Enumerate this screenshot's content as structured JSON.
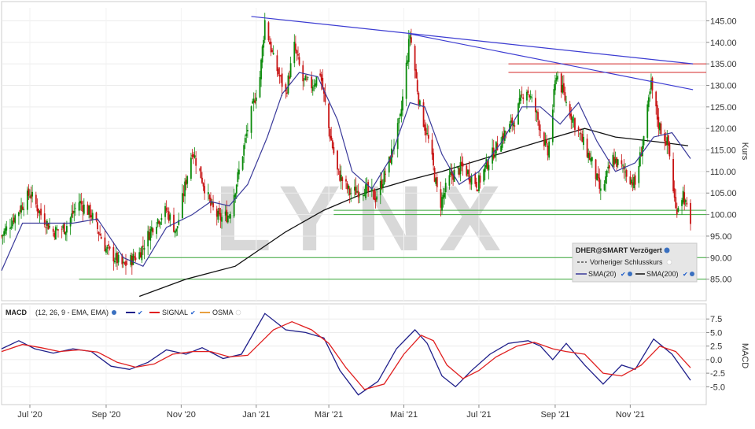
{
  "watermark": "LYNX",
  "chart_data": [
    {
      "type": "candlestick",
      "ylabel": "Kurs",
      "ylim": [
        80,
        148
      ],
      "y_ticks": [
        "85.00",
        "90.00",
        "95.00",
        "100.00",
        "105.00",
        "110.00",
        "115.00",
        "120.00",
        "125.00",
        "130.00",
        "135.00",
        "140.00",
        "145.00"
      ],
      "x_ticks": [
        "Jul '20",
        "Sep '20",
        "Nov '20",
        "Jan '21",
        "Mär '21",
        "Mai '21",
        "Jul '21",
        "Sep '21",
        "Nov '21"
      ],
      "x_range": [
        "2020-06-08",
        "2021-12-20"
      ],
      "legend": {
        "title": "DHER@SMART Verzögert",
        "items": [
          "Vorheriger Schlusskurs",
          "SMA(20)",
          "SMA(200)"
        ]
      },
      "colors": {
        "up": "#0a8a0a",
        "down": "#c81414",
        "sma20": "#3a3a9a",
        "sma200": "#111111",
        "trendline": "#3c3cd2",
        "resistance": "#d42a2a",
        "support": "#3aa83a"
      },
      "price_keypoints": [
        [
          "2020-06-08",
          95
        ],
        [
          "2020-06-22",
          101
        ],
        [
          "2020-07-01",
          105
        ],
        [
          "2020-07-10",
          100
        ],
        [
          "2020-07-20",
          96
        ],
        [
          "2020-07-30",
          97
        ],
        [
          "2020-08-10",
          103
        ],
        [
          "2020-08-20",
          100
        ],
        [
          "2020-09-01",
          92
        ],
        [
          "2020-09-15",
          88
        ],
        [
          "2020-09-28",
          91
        ],
        [
          "2020-10-10",
          98
        ],
        [
          "2020-10-20",
          101
        ],
        [
          "2020-10-28",
          96
        ],
        [
          "2020-11-05",
          108
        ],
        [
          "2020-11-10",
          115
        ],
        [
          "2020-11-16",
          110
        ],
        [
          "2020-11-25",
          102
        ],
        [
          "2020-12-02",
          99
        ],
        [
          "2020-12-10",
          100
        ],
        [
          "2020-12-18",
          110
        ],
        [
          "2020-12-25",
          120
        ],
        [
          "2021-01-04",
          132
        ],
        [
          "2021-01-08",
          145
        ],
        [
          "2021-01-15",
          136
        ],
        [
          "2021-01-25",
          128
        ],
        [
          "2021-02-01",
          139
        ],
        [
          "2021-02-08",
          131
        ],
        [
          "2021-02-15",
          130
        ],
        [
          "2021-02-22",
          133
        ],
        [
          "2021-03-01",
          120
        ],
        [
          "2021-03-08",
          110
        ],
        [
          "2021-03-18",
          105
        ],
        [
          "2021-03-30",
          106
        ],
        [
          "2021-04-08",
          104
        ],
        [
          "2021-04-18",
          111
        ],
        [
          "2021-04-28",
          122
        ],
        [
          "2021-05-06",
          142
        ],
        [
          "2021-05-14",
          125
        ],
        [
          "2021-05-22",
          116
        ],
        [
          "2021-05-30",
          102
        ],
        [
          "2021-06-08",
          109
        ],
        [
          "2021-06-18",
          111
        ],
        [
          "2021-06-30",
          107
        ],
        [
          "2021-07-08",
          112
        ],
        [
          "2021-07-20",
          118
        ],
        [
          "2021-07-30",
          122
        ],
        [
          "2021-08-08",
          130
        ],
        [
          "2021-08-16",
          124
        ],
        [
          "2021-08-26",
          114
        ],
        [
          "2021-09-02",
          133
        ],
        [
          "2021-09-10",
          126
        ],
        [
          "2021-09-20",
          119
        ],
        [
          "2021-10-01",
          112
        ],
        [
          "2021-10-08",
          105
        ],
        [
          "2021-10-18",
          113
        ],
        [
          "2021-10-28",
          110
        ],
        [
          "2021-11-05",
          107
        ],
        [
          "2021-11-12",
          118
        ],
        [
          "2021-11-18",
          130
        ],
        [
          "2021-11-24",
          121
        ],
        [
          "2021-12-02",
          116
        ],
        [
          "2021-12-08",
          101
        ],
        [
          "2021-12-14",
          105
        ],
        [
          "2021-12-20",
          97
        ]
      ],
      "sma20_keypoints": [
        [
          "2020-06-08",
          87
        ],
        [
          "2020-06-25",
          98
        ],
        [
          "2020-07-15",
          98
        ],
        [
          "2020-08-05",
          98
        ],
        [
          "2020-08-25",
          99
        ],
        [
          "2020-09-15",
          90
        ],
        [
          "2020-10-01",
          88
        ],
        [
          "2020-10-20",
          97
        ],
        [
          "2020-11-10",
          100
        ],
        [
          "2020-11-25",
          103
        ],
        [
          "2020-12-10",
          102
        ],
        [
          "2020-12-25",
          107
        ],
        [
          "2021-01-10",
          118
        ],
        [
          "2021-01-22",
          128
        ],
        [
          "2021-02-05",
          133
        ],
        [
          "2021-02-20",
          132
        ],
        [
          "2021-03-08",
          122
        ],
        [
          "2021-03-20",
          110
        ],
        [
          "2021-04-05",
          106
        ],
        [
          "2021-04-20",
          113
        ],
        [
          "2021-05-06",
          126
        ],
        [
          "2021-05-18",
          125
        ],
        [
          "2021-06-01",
          114
        ],
        [
          "2021-06-15",
          107
        ],
        [
          "2021-07-01",
          110
        ],
        [
          "2021-07-20",
          117
        ],
        [
          "2021-08-05",
          125
        ],
        [
          "2021-08-20",
          125
        ],
        [
          "2021-09-05",
          121
        ],
        [
          "2021-09-20",
          126
        ],
        [
          "2021-10-05",
          117
        ],
        [
          "2021-10-20",
          110
        ],
        [
          "2021-11-05",
          112
        ],
        [
          "2021-11-20",
          118
        ],
        [
          "2021-12-05",
          119
        ],
        [
          "2021-12-20",
          113
        ]
      ],
      "sma200_keypoints": [
        [
          "2020-09-28",
          81
        ],
        [
          "2020-11-05",
          85
        ],
        [
          "2020-12-15",
          88
        ],
        [
          "2021-01-25",
          96
        ],
        [
          "2021-02-25",
          101
        ],
        [
          "2021-03-30",
          105
        ],
        [
          "2021-05-05",
          108
        ],
        [
          "2021-06-01",
          110
        ],
        [
          "2021-07-05",
          113
        ],
        [
          "2021-08-20",
          117
        ],
        [
          "2021-09-25",
          120
        ],
        [
          "2021-10-20",
          118
        ],
        [
          "2021-11-20",
          117
        ],
        [
          "2021-12-18",
          116
        ]
      ],
      "trendlines": [
        {
          "kind": "trendline",
          "start": [
            "2020-12-28",
            146
          ],
          "end": [
            "2021-12-22",
            135
          ]
        },
        {
          "kind": "trendline",
          "start": [
            "2021-05-05",
            142
          ],
          "end": [
            "2021-12-22",
            129
          ]
        }
      ],
      "horizontal_levels": [
        {
          "kind": "resistance",
          "value": 135,
          "from": "2021-07-25"
        },
        {
          "kind": "resistance",
          "value": 133,
          "from": "2021-07-25"
        },
        {
          "kind": "support",
          "value": 101,
          "from": "2021-03-05"
        },
        {
          "kind": "support",
          "value": 100,
          "from": "2021-03-05"
        },
        {
          "kind": "support",
          "value": 90,
          "from": "2020-10-05"
        },
        {
          "kind": "support",
          "value": 85,
          "from": "2020-08-10"
        }
      ]
    },
    {
      "type": "line",
      "ylabel": "MACD",
      "ylim": [
        -8,
        10
      ],
      "y_ticks": [
        "-5.0",
        "-2.5",
        "0.0",
        "2.5",
        "5.0",
        "7.5"
      ],
      "legend": {
        "title": "MACD",
        "params": "(12, 26, 9 - EMA, EMA)",
        "items": [
          "SIGNAL",
          "OSMA"
        ]
      },
      "series": [
        {
          "name": "MACD",
          "color": "#1f1f8a",
          "points": [
            [
              "2020-06-08",
              2
            ],
            [
              "2020-06-22",
              3.5
            ],
            [
              "2020-07-05",
              2
            ],
            [
              "2020-07-20",
              1.2
            ],
            [
              "2020-08-05",
              2
            ],
            [
              "2020-08-20",
              1.5
            ],
            [
              "2020-09-05",
              -1.2
            ],
            [
              "2020-09-20",
              -1.8
            ],
            [
              "2020-10-05",
              -0.5
            ],
            [
              "2020-10-20",
              1.8
            ],
            [
              "2020-11-05",
              1
            ],
            [
              "2020-11-18",
              2.2
            ],
            [
              "2020-12-05",
              0.2
            ],
            [
              "2020-12-20",
              1
            ],
            [
              "2021-01-08",
              8.5
            ],
            [
              "2021-01-25",
              5.5
            ],
            [
              "2021-02-10",
              5
            ],
            [
              "2021-02-25",
              4
            ],
            [
              "2021-03-10",
              -2
            ],
            [
              "2021-03-25",
              -6.5
            ],
            [
              "2021-04-10",
              -4
            ],
            [
              "2021-04-25",
              2
            ],
            [
              "2021-05-10",
              5.5
            ],
            [
              "2021-05-20",
              3
            ],
            [
              "2021-06-01",
              -3
            ],
            [
              "2021-06-12",
              -5
            ],
            [
              "2021-06-25",
              -2
            ],
            [
              "2021-07-10",
              1
            ],
            [
              "2021-07-25",
              3
            ],
            [
              "2021-08-10",
              3.5
            ],
            [
              "2021-08-20",
              2.5
            ],
            [
              "2021-08-30",
              0
            ],
            [
              "2021-09-10",
              3
            ],
            [
              "2021-09-25",
              -1
            ],
            [
              "2021-10-10",
              -4.5
            ],
            [
              "2021-10-25",
              -1
            ],
            [
              "2021-11-05",
              -1.8
            ],
            [
              "2021-11-20",
              3.8
            ],
            [
              "2021-12-05",
              1
            ],
            [
              "2021-12-20",
              -3.8
            ]
          ]
        },
        {
          "name": "SIGNAL",
          "color": "#e02020",
          "points": [
            [
              "2020-06-08",
              1.5
            ],
            [
              "2020-06-25",
              2.8
            ],
            [
              "2020-07-10",
              2.2
            ],
            [
              "2020-07-25",
              1.5
            ],
            [
              "2020-08-10",
              1.8
            ],
            [
              "2020-08-25",
              1.4
            ],
            [
              "2020-09-10",
              -0.5
            ],
            [
              "2020-09-25",
              -1.4
            ],
            [
              "2020-10-10",
              -0.8
            ],
            [
              "2020-10-25",
              1
            ],
            [
              "2020-11-10",
              1.5
            ],
            [
              "2020-11-25",
              1.5
            ],
            [
              "2020-12-10",
              0.5
            ],
            [
              "2020-12-25",
              0.8
            ],
            [
              "2021-01-15",
              5.5
            ],
            [
              "2021-01-30",
              7
            ],
            [
              "2021-02-15",
              5.5
            ],
            [
              "2021-03-01",
              3
            ],
            [
              "2021-03-15",
              -1.5
            ],
            [
              "2021-03-30",
              -5.5
            ],
            [
              "2021-04-15",
              -4.5
            ],
            [
              "2021-05-01",
              1
            ],
            [
              "2021-05-15",
              4.5
            ],
            [
              "2021-05-25",
              3.5
            ],
            [
              "2021-06-05",
              -1
            ],
            [
              "2021-06-18",
              -3.5
            ],
            [
              "2021-07-01",
              -2
            ],
            [
              "2021-07-15",
              0.5
            ],
            [
              "2021-08-01",
              2.5
            ],
            [
              "2021-08-15",
              3.2
            ],
            [
              "2021-08-30",
              2
            ],
            [
              "2021-09-10",
              1.5
            ],
            [
              "2021-09-25",
              1
            ],
            [
              "2021-10-10",
              -2.5
            ],
            [
              "2021-10-25",
              -3
            ],
            [
              "2021-11-10",
              -1
            ],
            [
              "2021-11-25",
              2.5
            ],
            [
              "2021-12-08",
              1.5
            ],
            [
              "2021-12-20",
              -1.5
            ]
          ]
        }
      ],
      "x_ticks": [
        "Jul '20",
        "Sep '20",
        "Nov '20",
        "Jan '21",
        "Mär '21",
        "Mai '21",
        "Jul '21",
        "Sep '21",
        "Nov '21"
      ]
    }
  ]
}
